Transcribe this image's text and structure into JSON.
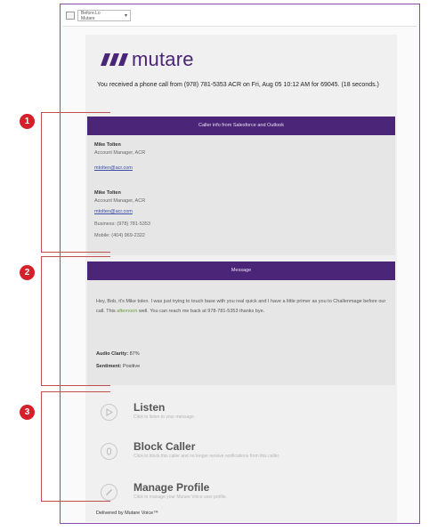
{
  "toolbar": {
    "select_line1": "Before.Lo",
    "select_line2": "Mutare"
  },
  "brand": {
    "logo_text": "mutare",
    "accent": "#4a2578",
    "marker_red": "#d51f2a"
  },
  "intro": "You received a phone call from (978) 781-5353 ACR on Fri, Aug 05 10:12 AM for 69045. (18 seconds.)",
  "caller_info": {
    "header": "Caller info from Salesforce and Outlook",
    "contacts": [
      {
        "name": "Mike Tolten",
        "lines": [
          "Account Manager, ACR"
        ],
        "email": "mtolten@acr.com",
        "phones": []
      },
      {
        "name": "Mike Tolten",
        "lines": [
          "Account Manager, ACR"
        ],
        "email": "mtolten@acr.com",
        "phones": [
          "Business: (978) 781-5353",
          "Mobile: (404) 969-2322"
        ]
      }
    ]
  },
  "message": {
    "header": "Message",
    "text_before": "Hey, Bob, it's Mike tolen. I was just trying to touch base with you real quick and I have a little primer as you to Challenmage before our call. This ",
    "text_highlight": "afternoon",
    "text_after": " well. You can reach me back at 978-781-5353 thanks bye.",
    "audio_clarity_label": "Audio Clarity:",
    "audio_clarity_value": "87%",
    "sentiment_label": "Sentiment:",
    "sentiment_value": "Positive"
  },
  "actions": [
    {
      "title": "Listen",
      "subtitle": "Click to listen to your message.",
      "icon": "play-icon"
    },
    {
      "title": "Block Caller",
      "subtitle": "Click to block this caller and no longer receive notifications from this caller.",
      "icon": "hand-icon"
    },
    {
      "title": "Manage Profile",
      "subtitle": "Click to manage your Mutare Voice user profile.",
      "icon": "pencil-icon"
    }
  ],
  "footer": "Delivered by Mutare Voice™",
  "markers": [
    "1",
    "2",
    "3"
  ]
}
